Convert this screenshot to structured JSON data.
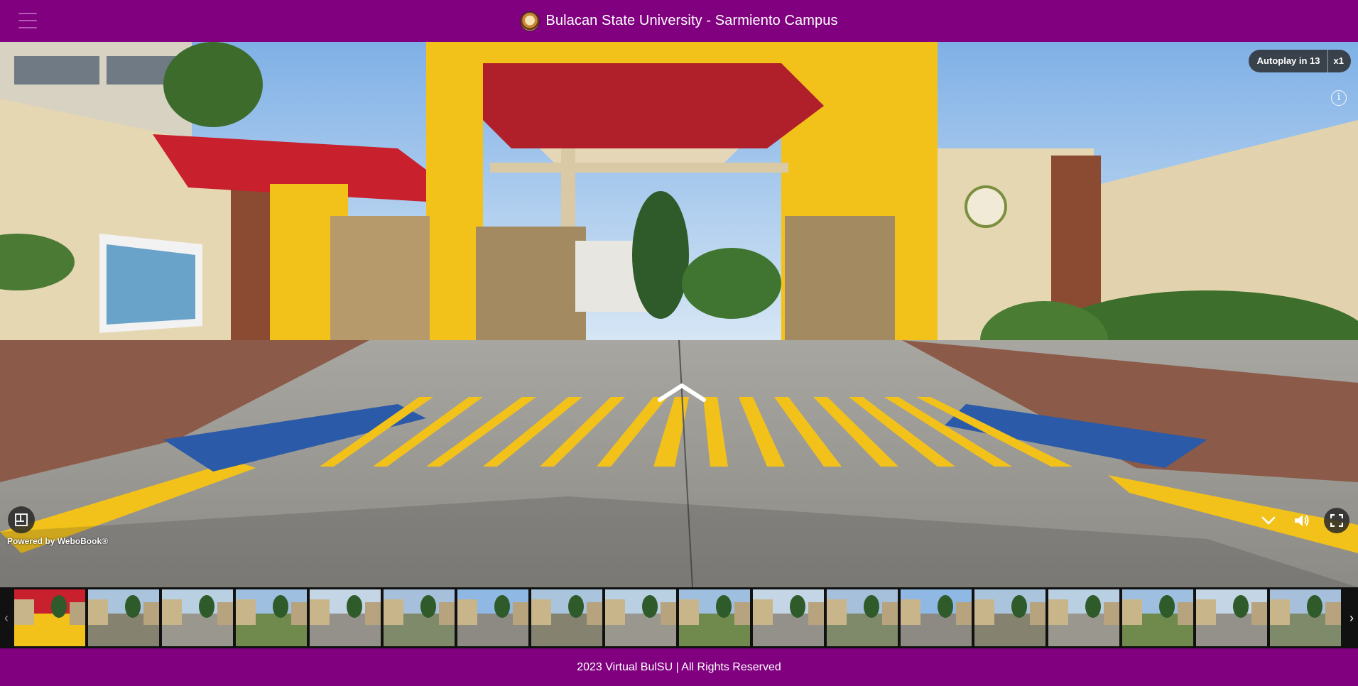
{
  "header": {
    "title": "Bulacan State University - Sarmiento Campus",
    "menu_icon": "hamburger-icon",
    "logo_icon": "university-seal-logo"
  },
  "viewer": {
    "autoplay_label": "Autoplay in 13",
    "autoplay_speed": "x1",
    "info_icon_glyph": "i",
    "powered_by": "Powered by WeboBook®",
    "icons": {
      "floorplan": "floorplan-icon",
      "navigate": "navigate-forward-arrow-icon",
      "collapse": "chevron-down-icon",
      "volume": "volume-icon",
      "fullscreen": "fullscreen-icon"
    }
  },
  "thumbnails": {
    "count": 18,
    "active_index": 0,
    "prev_glyph": "‹",
    "next_glyph": "›"
  },
  "footer": {
    "copyright": "2023 Virtual BulSU | All Rights Reserved"
  },
  "colors": {
    "brand_purple": "#80007f",
    "road_yellow": "#f2c21b",
    "gate_red": "#c8202c",
    "accessible_blue": "#2a5aa8"
  }
}
